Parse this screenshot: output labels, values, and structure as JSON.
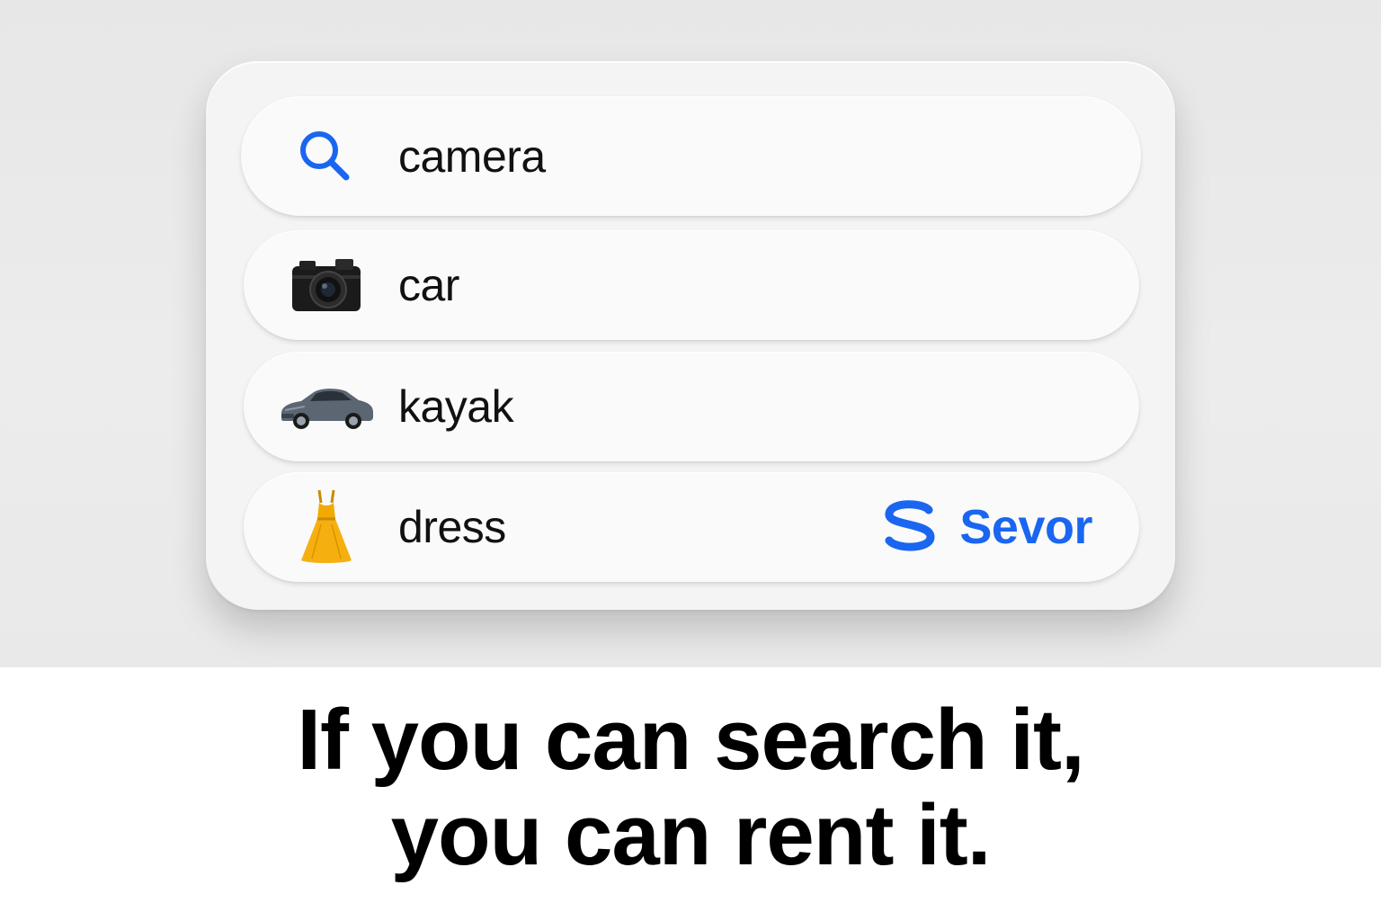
{
  "colors": {
    "accent": "#1a66f0",
    "text": "#111111",
    "background_top": "#e9e9e9",
    "card": "#f4f4f4"
  },
  "search": {
    "icon": "search-icon",
    "value": "camera"
  },
  "suggestions": [
    {
      "icon": "camera-icon",
      "label": "car"
    },
    {
      "icon": "car-icon",
      "label": "kayak"
    },
    {
      "icon": "dress-icon",
      "label": "dress"
    }
  ],
  "brand": {
    "logo": "sevor-logo-icon",
    "name": "Sevor"
  },
  "tagline": {
    "line1": "If you can search it,",
    "line2": "you can rent it."
  }
}
